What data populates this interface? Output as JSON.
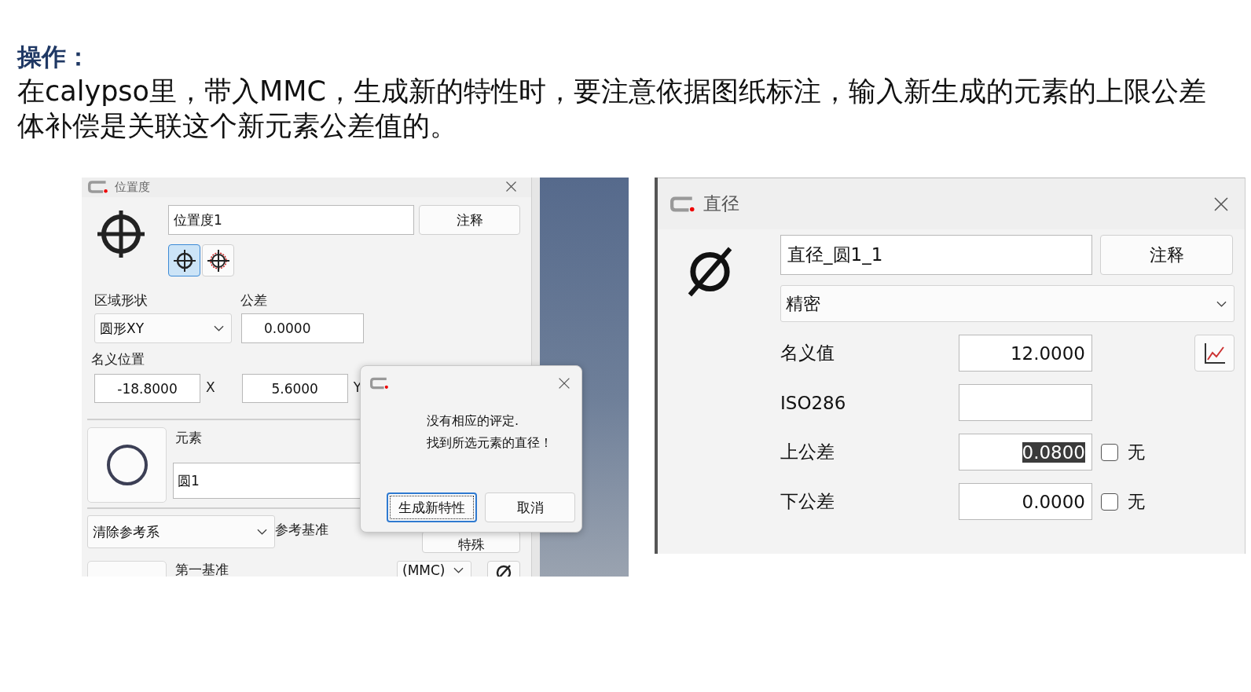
{
  "heading": "操作：",
  "paragraph_lines": [
    "在calypso里，带入MMC，生成新的特性时，要注意依据图纸标注，输入新生成的元素的上限公差",
    "体补偿是关联这个新元素公差值的。"
  ],
  "position_dialog": {
    "title": "位置度",
    "name_value": "位置度1",
    "comment_button": "注释",
    "tolerance_types": [
      {
        "selected": true
      },
      {
        "selected": false
      }
    ],
    "zone_shape_label": "区域形状",
    "zone_shape_value": "圆形XY",
    "tolerance_label": "公差",
    "tolerance_value": "0.0000",
    "nominal_label": "名义位置",
    "nominal": [
      {
        "value": "-18.8000",
        "axis": "X"
      },
      {
        "value": "5.6000",
        "axis": "Y"
      }
    ],
    "element_label": "元素",
    "element_value": "圆1",
    "reference_dropdown": "清除参考系",
    "reference_label": "参考基准",
    "special_button": "特殊",
    "first_datum_label": "第一基准",
    "datum_modifier": "(MMC)"
  },
  "message_box": {
    "lines": [
      "没有相应的评定.",
      "找到所选元素的直径！"
    ],
    "buttons": [
      {
        "label": "生成新特性",
        "focused": true
      },
      {
        "label": "取消",
        "focused": false
      }
    ]
  },
  "diameter_dialog": {
    "title": "直径",
    "name_value": "直径_圆1_1",
    "comment_button": "注释",
    "fit_dropdown": "精密",
    "rows": [
      {
        "kind": "nominal",
        "label": "名义值",
        "value": "12.0000"
      },
      {
        "kind": "plain",
        "label": "ISO286"
      },
      {
        "kind": "tolerance",
        "label": "上公差",
        "value": "0.0800",
        "text_selected": true,
        "none_checkbox": {
          "label": "无",
          "checked": false
        }
      },
      {
        "kind": "tolerance",
        "label": "下公差",
        "value": "0.0000",
        "text_selected": false,
        "none_checkbox": {
          "label": "无",
          "checked": false
        }
      }
    ]
  }
}
